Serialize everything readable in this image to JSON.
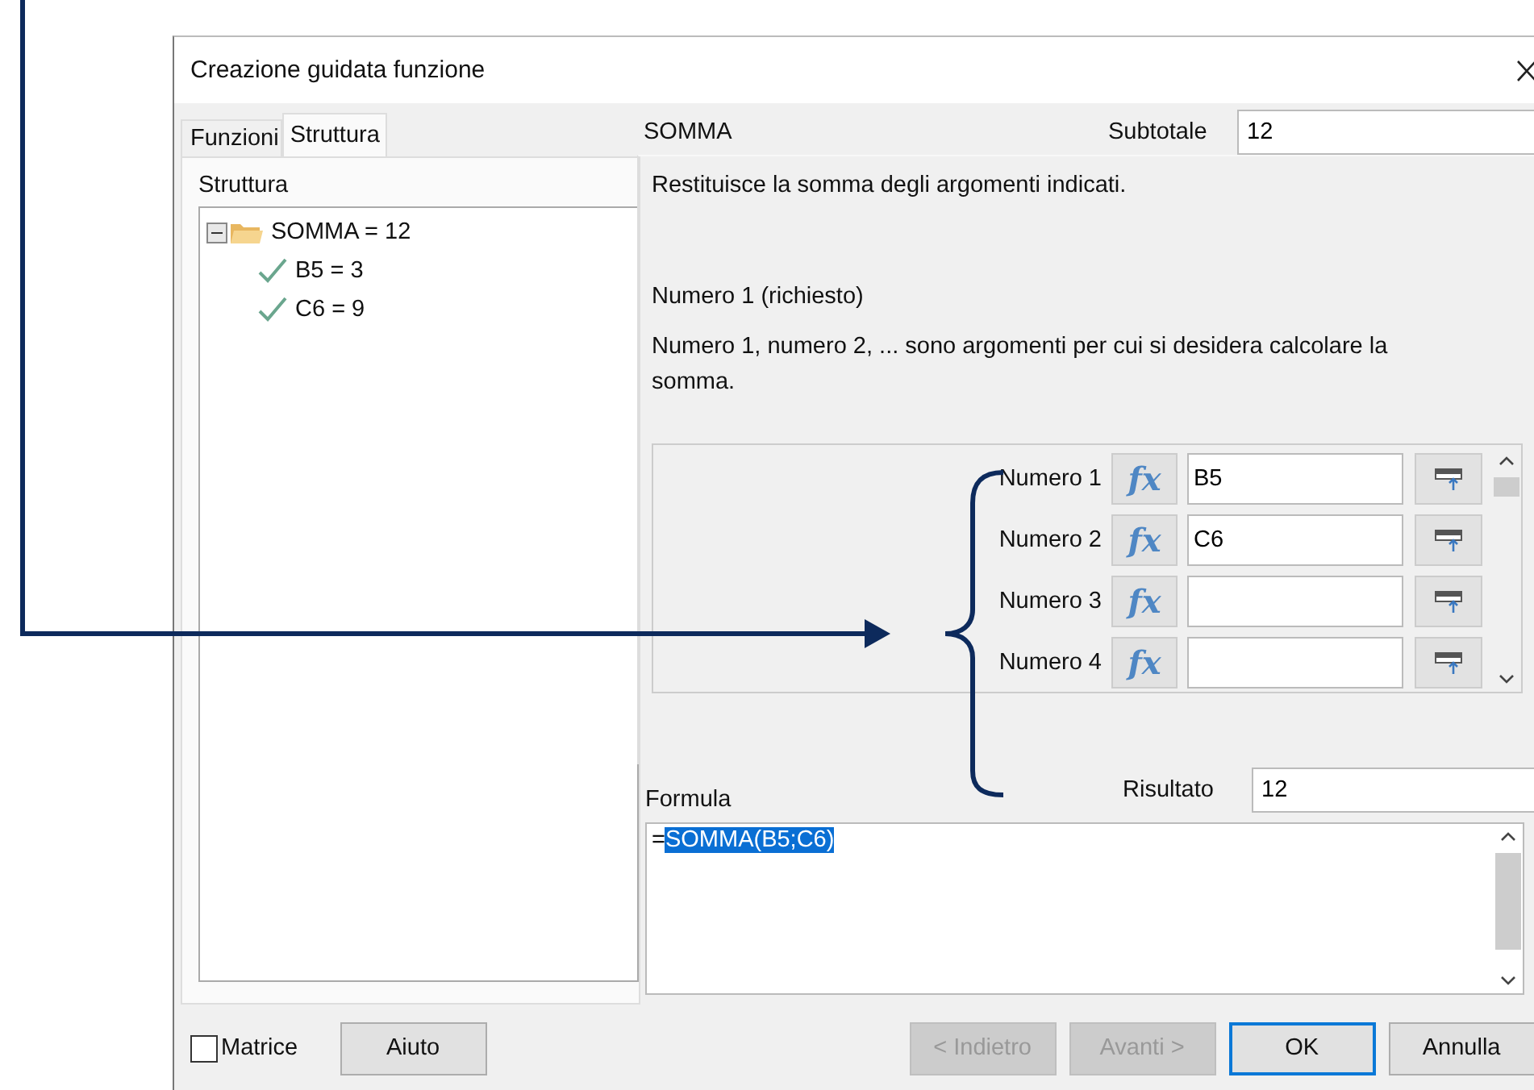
{
  "window": {
    "title": "Creazione guidata funzione"
  },
  "tabs": [
    {
      "label": "Funzioni",
      "selected": false
    },
    {
      "label": "Struttura",
      "selected": true
    }
  ],
  "structure": {
    "label": "Struttura",
    "tree": [
      {
        "label": "SOMMA = 12",
        "kind": "function",
        "expanded": true,
        "children": [
          {
            "label": "B5 = 3",
            "kind": "value"
          },
          {
            "label": "C6 = 9",
            "kind": "value"
          }
        ]
      }
    ]
  },
  "function_name": "SOMMA",
  "subtotal": {
    "label": "Subtotale",
    "value": "12"
  },
  "description": "Restituisce la somma degli argomenti indicati.",
  "argument_title": "Numero 1 (richiesto)",
  "argument_description": "Numero 1, numero 2, ... sono argomenti per cui si desidera calcolare la somma.",
  "arguments": [
    {
      "label": "Numero 1",
      "fx": "fx",
      "value": "B5"
    },
    {
      "label": "Numero 2",
      "fx": "fx",
      "value": "C6"
    },
    {
      "label": "Numero 3",
      "fx": "fx"
    },
    {
      "label": "Numero 4",
      "fx": "fx"
    }
  ],
  "formula": {
    "label": "Formula",
    "prefix": "=",
    "selected_text": "SOMMA(B5;C6)"
  },
  "result": {
    "label": "Risultato",
    "value": "12"
  },
  "array_checkbox": {
    "label": "Matrice",
    "checked": false
  },
  "help_button": "Aiuto",
  "buttons": [
    {
      "label": "< Indietro",
      "disabled": true,
      "default": false
    },
    {
      "label": "Avanti >",
      "disabled": true,
      "default": false
    },
    {
      "label": "OK",
      "disabled": false,
      "default": true
    },
    {
      "label": "Annulla",
      "disabled": false,
      "default": false
    }
  ]
}
